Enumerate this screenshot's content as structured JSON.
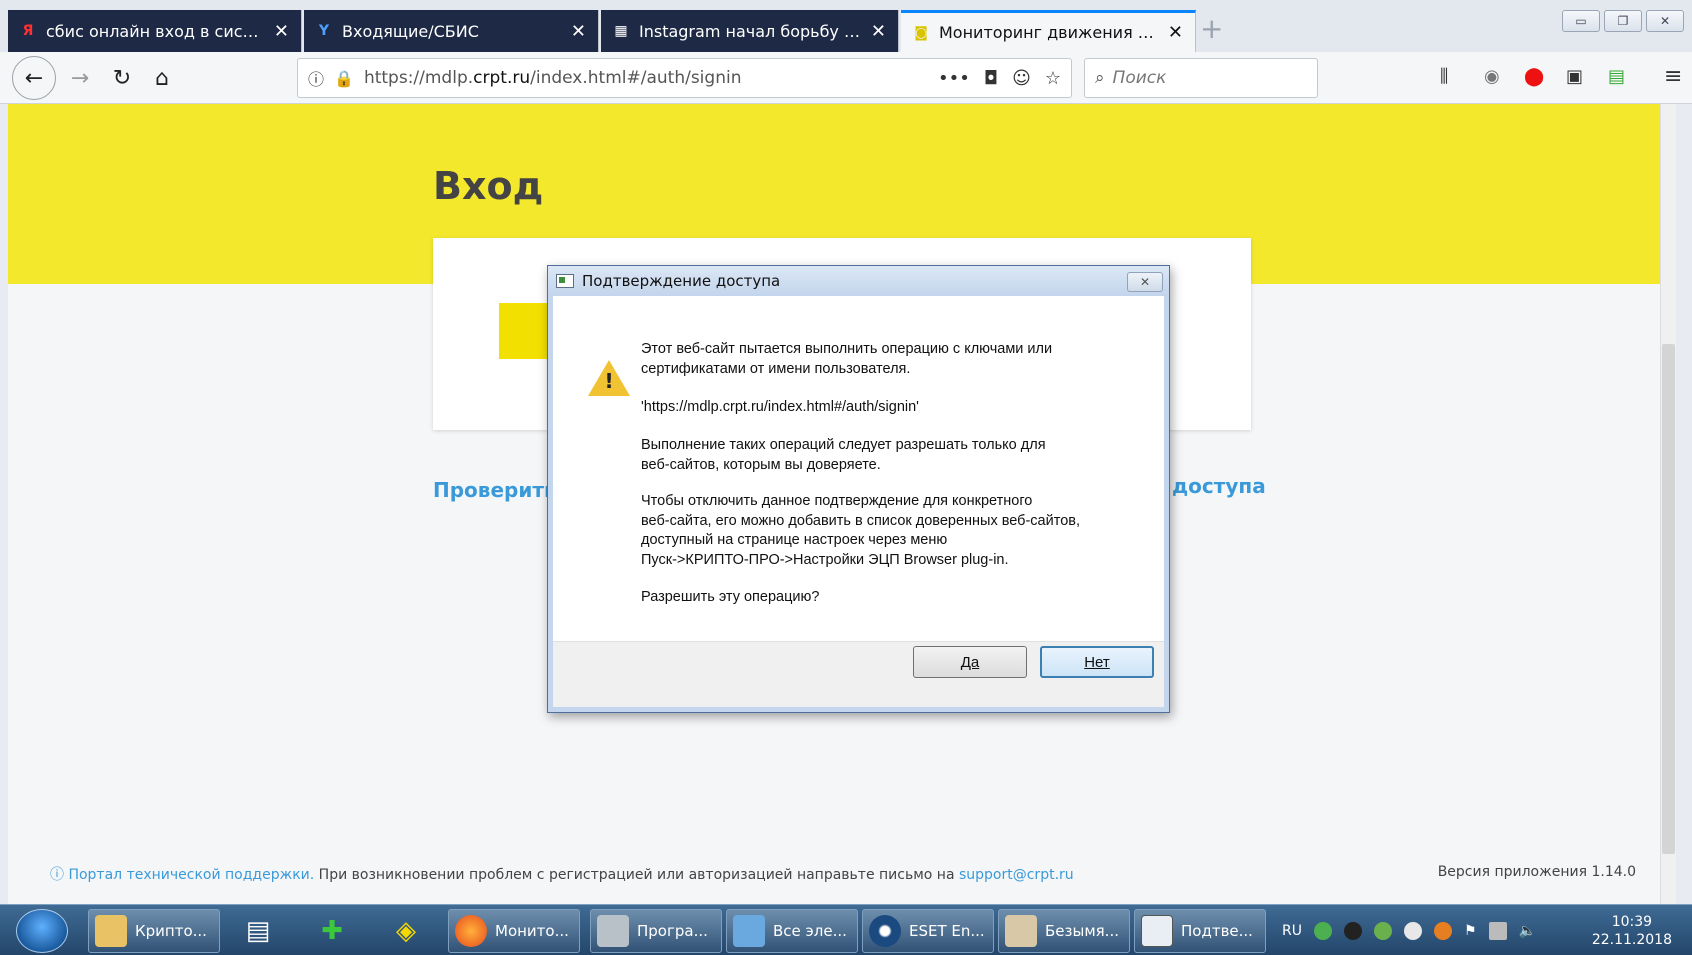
{
  "browser": {
    "tabs": [
      {
        "title": "сбис онлайн вход в систему - ",
        "favicon": "Я",
        "favicon_color": "#ff0000"
      },
      {
        "title": "Входящие/СБИС",
        "favicon": "Y",
        "favicon_color": "#2b7de9"
      },
      {
        "title": "Instagram начал борьбу с нак",
        "favicon": "▦",
        "favicon_color": "#333333"
      },
      {
        "title": "Мониторинг движения лекар",
        "favicon": "◙",
        "favicon_color": "#d8c400"
      }
    ],
    "url_prefix": "https://mdlp.",
    "url_domain": "crpt.ru",
    "url_suffix": "/index.html#/auth/signin",
    "search_placeholder": "Поиск"
  },
  "page": {
    "title": "Вход",
    "link_left": "Проверить",
    "link_right": "доступа",
    "footer_link": "Портал технической поддержки.",
    "footer_text": " При возникновении проблем с регистрацией или авторизацией направьте письмо на ",
    "footer_email": "support@crpt.ru",
    "version": "Версия приложения 1.14.0",
    "accent_color": "#f4e82d"
  },
  "dialog": {
    "title": "Подтверждение доступа",
    "para1_line1": "Этот веб-сайт пытается выполнить операцию с ключами или",
    "para1_line2": "сертификатами от имени пользователя.",
    "url_line": " 'https://mdlp.crpt.ru/index.html#/auth/signin'",
    "para2_line1": "Выполнение таких операций следует разрешать только для",
    "para2_line2": "веб-сайтов, которым вы доверяете.",
    "para3_line1": "Чтобы отключить данное подтверждение для конкретного",
    "para3_line2": "веб-сайта, его можно добавить в список доверенных веб-сайтов,",
    "para3_line3": "доступный на странице настроек через меню",
    "para3_line4": "Пуск->КРИПТО-ПРО->Настройки ЭЦП Browser plug-in.",
    "question": "Разрешить эту операцию?",
    "yes_label": "Да",
    "no_label": "Нет"
  },
  "taskbar": {
    "tasks": [
      {
        "label": "Крипто...",
        "icon": "folder-icon"
      },
      {
        "label": "Монито...",
        "icon": "firefox-icon"
      },
      {
        "label": "Програ...",
        "icon": "program-icon"
      },
      {
        "label": "Все эле...",
        "icon": "control-panel-icon"
      },
      {
        "label": "ESET En...",
        "icon": "eset-icon"
      },
      {
        "label": "Безымя...",
        "icon": "paint-icon"
      },
      {
        "label": "Подтве...",
        "icon": "dialog-icon"
      }
    ],
    "lang": "RU",
    "time": "10:39",
    "date": "22.11.2018"
  }
}
